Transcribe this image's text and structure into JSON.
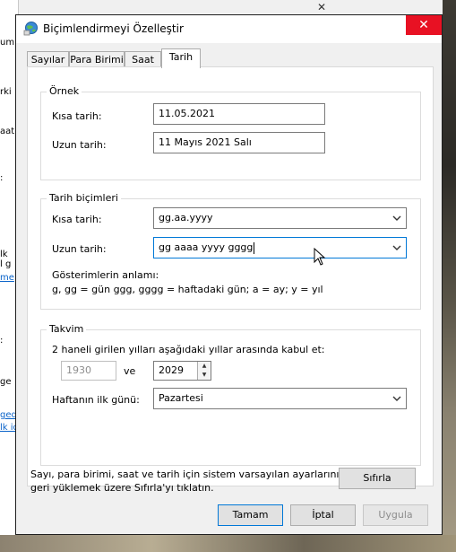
{
  "background": {
    "left_fragments": [
      "um",
      "rki",
      "aat",
      ":",
      "lk",
      "l g",
      "me",
      ":",
      "ge",
      "ged",
      "lk id"
    ]
  },
  "window": {
    "title": "Biçimlendirmeyi Özelleştir",
    "icon": "globe-icon",
    "close_glyph": "✕"
  },
  "tabs": [
    {
      "label": "Sayılar",
      "active": false
    },
    {
      "label": "Para Birimi",
      "active": false
    },
    {
      "label": "Saat",
      "active": false
    },
    {
      "label": "Tarih",
      "active": true
    }
  ],
  "ornek": {
    "title": "Örnek",
    "short_label": "Kısa tarih:",
    "short_value": "11.05.2021",
    "long_label": "Uzun tarih:",
    "long_value": "11 Mayıs 2021 Salı"
  },
  "formats": {
    "title": "Tarih biçimleri",
    "short_label": "Kısa tarih:",
    "short_value": "gg.aa.yyyy",
    "long_label": "Uzun tarih:",
    "long_value": "gg aaaa yyyy gggg",
    "meaning_title": "Gösterimlerin anlamı:",
    "meaning_text": "g, gg = gün  ggg, gggg = haftadaki gün;  a = ay;  y = yıl"
  },
  "calendar": {
    "title": "Takvim",
    "two_digit_text": "2 haneli girilen yılları aşağıdaki yıllar arasında kabul et:",
    "from_year": "1930",
    "and_label": "ve",
    "to_year": "2029",
    "first_day_label": "Haftanın ilk günü:",
    "first_day_value": "Pazartesi"
  },
  "footer": {
    "reset_text_line1": "Sayı, para birimi, saat ve tarih için sistem varsayılan ayarlarını",
    "reset_text_line2": "geri yüklemek üzere Sıfırla'yı tıklatın.",
    "reset_button": "Sıfırla"
  },
  "buttons": {
    "ok": "Tamam",
    "cancel": "İptal",
    "apply": "Uygula"
  },
  "colors": {
    "close_red": "#e81123",
    "focus_blue": "#0078d7"
  }
}
